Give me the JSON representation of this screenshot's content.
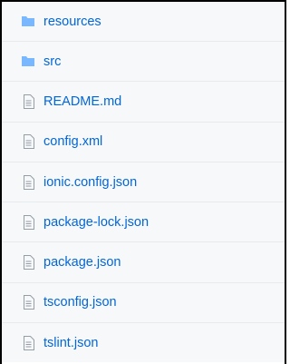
{
  "colors": {
    "link": "#0366d6",
    "folder_icon": "#79b8ff",
    "file_icon": "#959da5",
    "row_background": "#f6f8fa",
    "row_divider": "#e7ebee"
  },
  "file_list": [
    {
      "type": "folder",
      "icon": "folder-icon",
      "name": "resources"
    },
    {
      "type": "folder",
      "icon": "folder-icon",
      "name": "src"
    },
    {
      "type": "file",
      "icon": "file-text-icon",
      "name": "README.md"
    },
    {
      "type": "file",
      "icon": "file-text-icon",
      "name": "config.xml"
    },
    {
      "type": "file",
      "icon": "file-text-icon",
      "name": "ionic.config.json"
    },
    {
      "type": "file",
      "icon": "file-text-icon",
      "name": "package-lock.json"
    },
    {
      "type": "file",
      "icon": "file-text-icon",
      "name": "package.json"
    },
    {
      "type": "file",
      "icon": "file-text-icon",
      "name": "tsconfig.json"
    },
    {
      "type": "file",
      "icon": "file-text-icon",
      "name": "tslint.json"
    }
  ]
}
